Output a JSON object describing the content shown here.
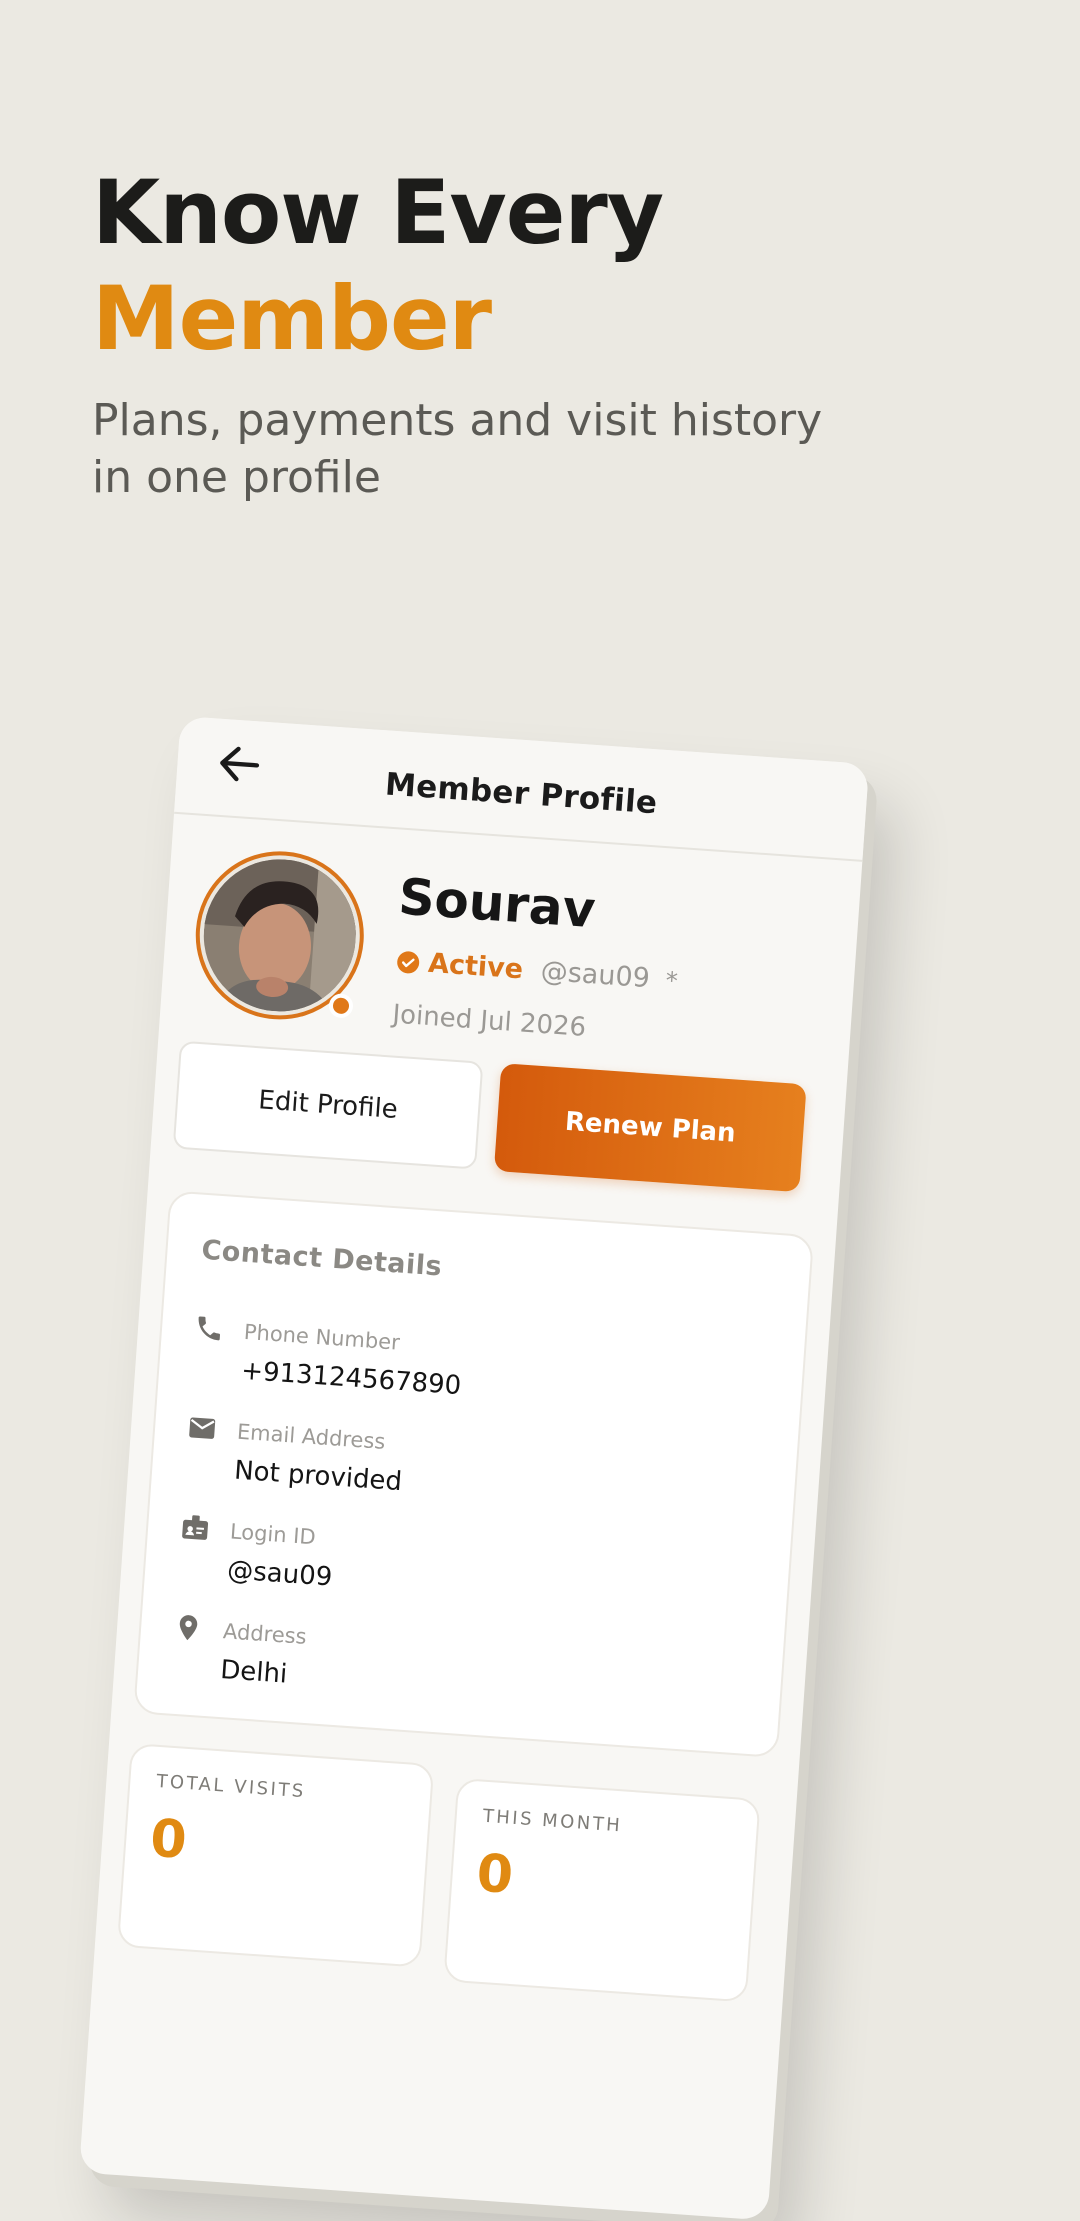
{
  "hero": {
    "line1": "Know Every",
    "line2": "Member",
    "subtitle": "Plans, payments and visit history in one profile"
  },
  "appbar": {
    "back_icon": "arrow-left-icon",
    "title": "Member Profile"
  },
  "profile": {
    "name": "Sourav",
    "status": "Active",
    "username": "@sau09",
    "separator": "*",
    "joined": "Joined Jul 2026",
    "status_color": "#e07818"
  },
  "buttons": {
    "edit_label": "Edit Profile",
    "renew_label": "Renew Plan"
  },
  "contact": {
    "title": "Contact Details",
    "items": [
      {
        "icon": "phone-icon",
        "label": "Phone Number",
        "value": "+913124567890"
      },
      {
        "icon": "mail-icon",
        "label": "Email Address",
        "value": "Not provided"
      },
      {
        "icon": "id-badge-icon",
        "label": "Login ID",
        "value": "@sau09"
      },
      {
        "icon": "location-pin-icon",
        "label": "Address",
        "value": "Delhi"
      }
    ]
  },
  "stats": [
    {
      "label": "TOTAL VISITS",
      "value": "0"
    },
    {
      "label": "THIS MONTH",
      "value": "0"
    }
  ],
  "colors": {
    "accent": "#e08a12",
    "accent_dark": "#d45a0c",
    "background": "#ebe9e2"
  }
}
